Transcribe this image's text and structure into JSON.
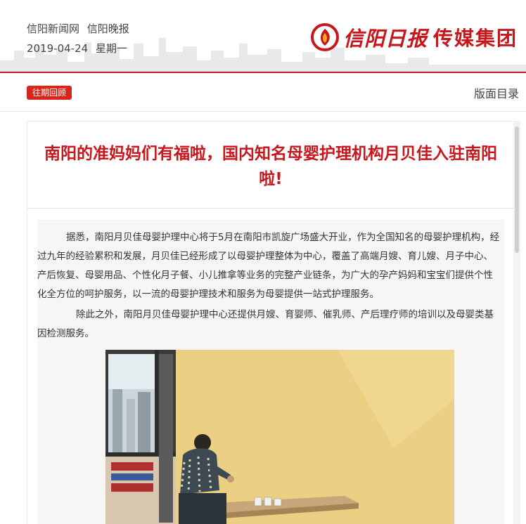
{
  "header": {
    "site_name": "信阳新闻网",
    "paper_name": "信阳晚报",
    "date": "2019-04-24",
    "weekday": "星期一",
    "brand_script": "信阳日报",
    "brand_name": "传媒集团",
    "logo_icon": "fire-ring-logo-icon",
    "accent_color": "#c8161d"
  },
  "toolbar": {
    "archive_label": "往期回顾",
    "toc_label": "版面目录"
  },
  "article": {
    "title": "南阳的准妈妈们有福啦，国内知名母婴护理机构月贝佳入驻南阳啦!",
    "paragraphs": [
      "据悉，南阳月贝佳母婴护理中心将于5月在南阳市凯旋广场盛大开业，作为全国知名的母婴护理机构，经过九年的经验累积和发展，月贝佳已经形成了以母婴护理整体为中心，覆盖了高端月嫂、育儿嫂、月子中心、产后恢复、母婴用品、个性化月子餐、小儿推拿等业务的完整产业链条，为广大的孕产妈妈和宝宝们提供个性化全方位的呵护服务，以一流的母婴护理技术和服务为母婴提供一站式护理服务。",
      "除此之外，南阳月贝佳母婴护理中心还提供月嫂、育婴师、催乳师、产后理疗师的培训以及母婴类基因检测服务。"
    ],
    "photo_icon": "renovation-worker-photo"
  }
}
